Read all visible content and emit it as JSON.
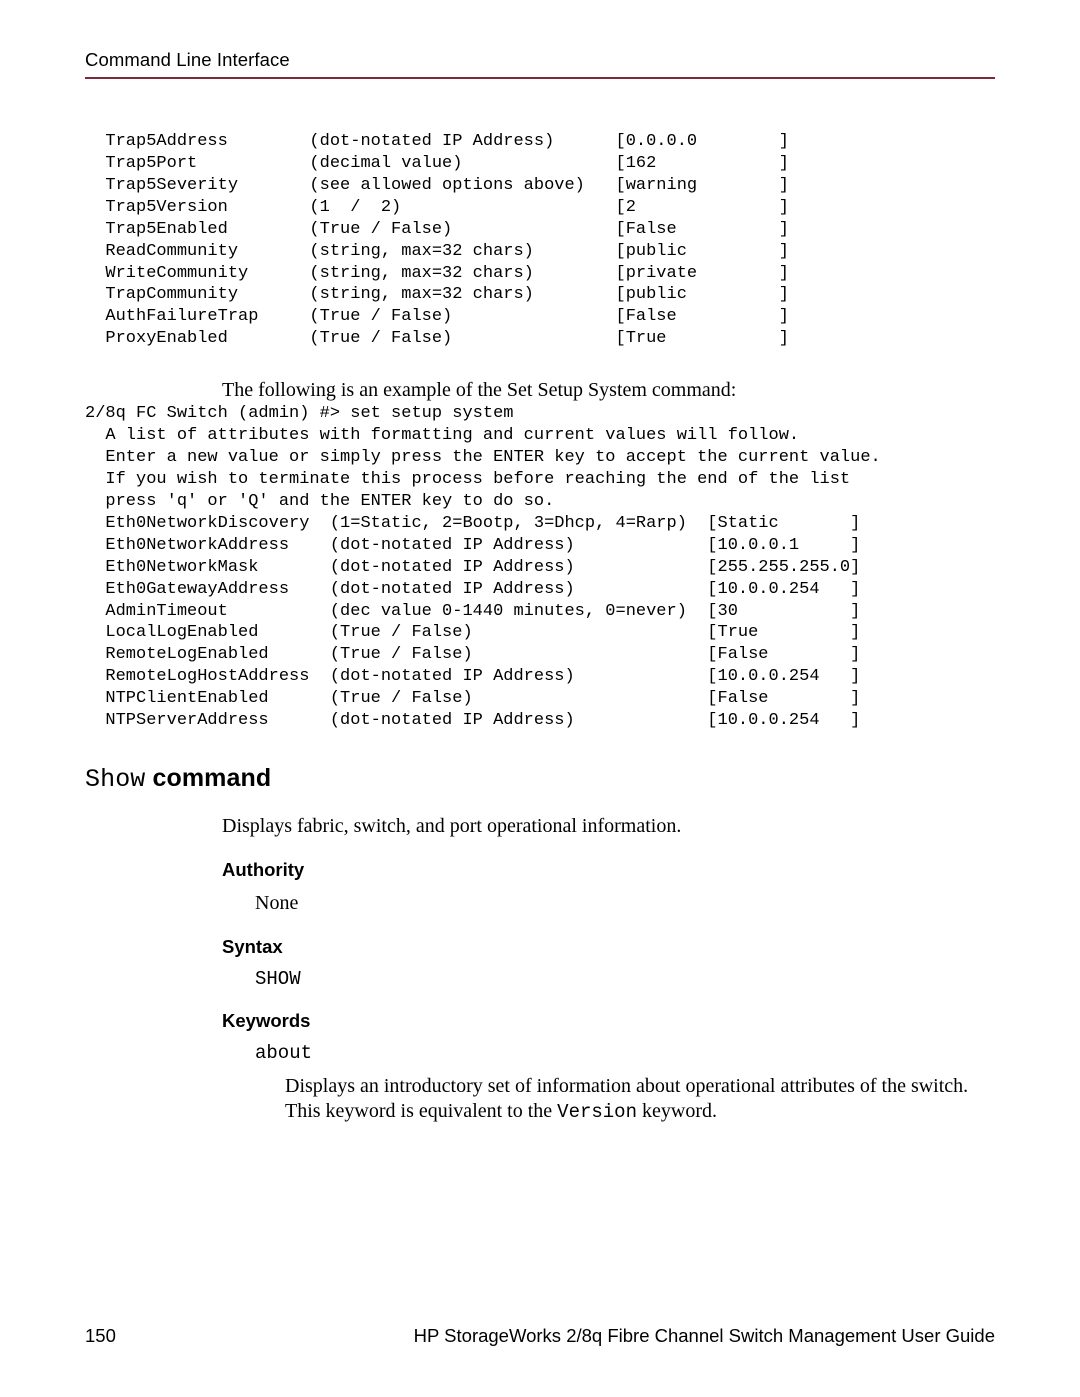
{
  "header": {
    "running_head": "Command Line Interface"
  },
  "blocks": {
    "trap_table": "  Trap5Address        (dot-notated IP Address)      [0.0.0.0        ]\n  Trap5Port           (decimal value)               [162            ]\n  Trap5Severity       (see allowed options above)   [warning        ]\n  Trap5Version        (1  /  2)                     [2              ]\n  Trap5Enabled        (True / False)                [False          ]\n  ReadCommunity       (string, max=32 chars)        [public         ]\n  WriteCommunity      (string, max=32 chars)        [private        ]\n  TrapCommunity       (string, max=32 chars)        [public         ]\n  AuthFailureTrap     (True / False)                [False          ]\n  ProxyEnabled        (True / False)                [True           ]",
    "setup_intro": "The following is an example of the Set Setup System command:",
    "setup_preamble": "2/8q FC Switch (admin) #> set setup system\n  A list of attributes with formatting and current values will follow.\n  Enter a new value or simply press the ENTER key to accept the current value.\n  If you wish to terminate this process before reaching the end of the list\n  press 'q' or 'Q' and the ENTER key to do so.",
    "eth_table": "  Eth0NetworkDiscovery  (1=Static, 2=Bootp, 3=Dhcp, 4=Rarp)  [Static       ]\n  Eth0NetworkAddress    (dot-notated IP Address)             [10.0.0.1     ]\n  Eth0NetworkMask       (dot-notated IP Address)             [255.255.255.0]\n  Eth0GatewayAddress    (dot-notated IP Address)             [10.0.0.254   ]\n  AdminTimeout          (dec value 0-1440 minutes, 0=never)  [30           ]\n  LocalLogEnabled       (True / False)                       [True         ]\n  RemoteLogEnabled      (True / False)                       [False        ]\n  RemoteLogHostAddress  (dot-notated IP Address)             [10.0.0.254   ]\n  NTPClientEnabled      (True / False)                       [False        ]\n  NTPServerAddress      (dot-notated IP Address)             [10.0.0.254   ]"
  },
  "show": {
    "heading_cmd": "Show",
    "heading_label": " command",
    "desc": "Displays fabric, switch, and port operational information.",
    "authority_label": "Authority",
    "authority_value": "None",
    "syntax_label": "Syntax",
    "syntax_value": "SHOW",
    "keywords_label": "Keywords",
    "kw_about": "about",
    "kw_about_desc_pre": "Displays an introductory set of information about operational attributes of the switch. This keyword is equivalent to the ",
    "kw_about_desc_code": "Version",
    "kw_about_desc_post": " keyword."
  },
  "footer": {
    "page_number": "150",
    "doc_title": "HP StorageWorks 2/8q Fibre Channel Switch Management User Guide"
  }
}
